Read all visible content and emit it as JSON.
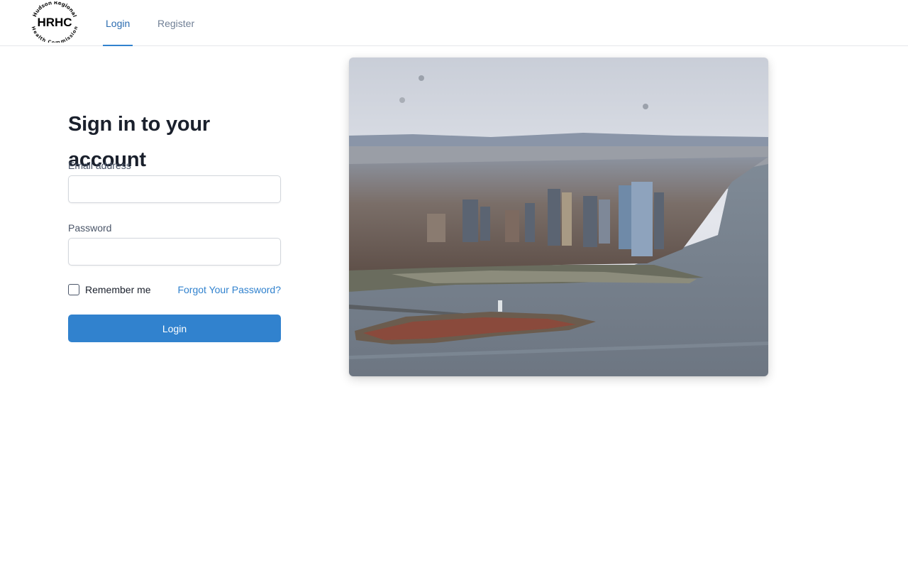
{
  "header": {
    "logo_text": "HRHC",
    "logo_arc_top": "Hudson Regional",
    "logo_arc_bottom": "Health Commission",
    "nav": [
      {
        "label": "Login",
        "active": true
      },
      {
        "label": "Register",
        "active": false
      }
    ]
  },
  "form": {
    "heading": "Sign in to your account",
    "email_label": "Email address",
    "email_value": "",
    "password_label": "Password",
    "password_value": "",
    "remember_label": "Remember me",
    "remember_checked": false,
    "forgot_label": "Forgot Your Password?",
    "login_button": "Login"
  },
  "hero": {
    "icon": "city-aerial-photo"
  },
  "colors": {
    "accent": "#3182ce",
    "nav_active": "#2b6cb0",
    "nav_inactive": "#718096",
    "text_dark": "#1a202c",
    "label": "#4a5568"
  }
}
